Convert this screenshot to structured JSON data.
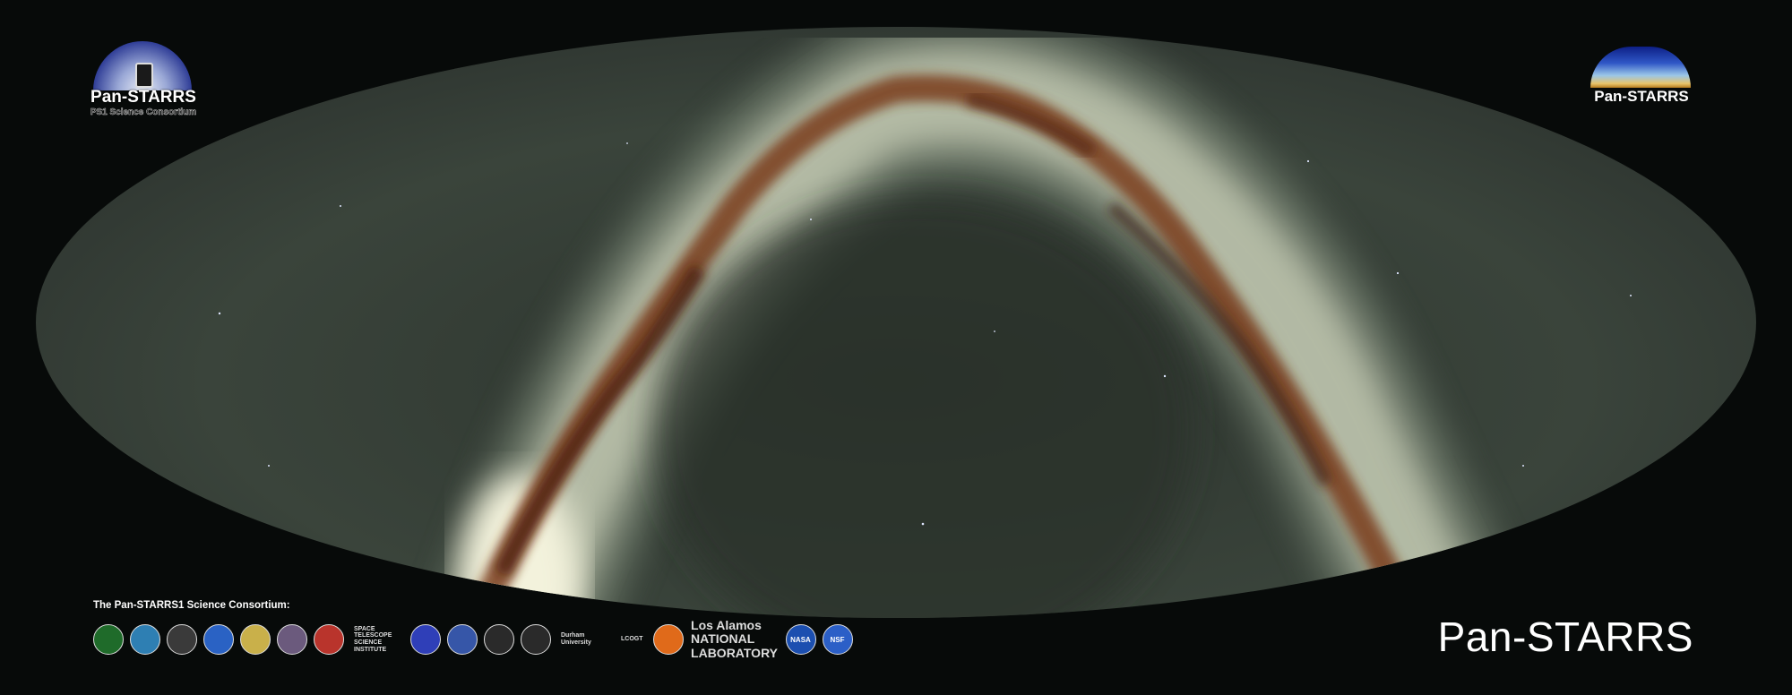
{
  "image": {
    "subject": "all-sky-milky-way",
    "colors": {
      "background": "#070a09",
      "sky_glow": "#3f4a41",
      "band_core": "#e9eedc",
      "dust": "#6a3318"
    }
  },
  "logos": {
    "top_left": {
      "icon": "pan-starrs-consortium-logo",
      "title": "Pan-STARRS",
      "subtitle": "PS1 Science Consortium"
    },
    "top_right": {
      "icon": "pan-starrs-logo",
      "title": "Pan-STARRS"
    }
  },
  "consortium_label": "The Pan-STARRS1 Science Consortium:",
  "partners": [
    {
      "icon": "partner-seal-icon",
      "color": "#1f6b2a",
      "text": ""
    },
    {
      "icon": "partner-seal-icon",
      "color": "#2e7fb3",
      "text": ""
    },
    {
      "icon": "partner-ring-icon",
      "color": "#3a3a3a",
      "text": ""
    },
    {
      "icon": "partner-seal-icon",
      "color": "#2a62c4",
      "text": ""
    },
    {
      "icon": "partner-seal-icon",
      "color": "#c9b04a",
      "text": ""
    },
    {
      "icon": "partner-shield-icon",
      "color": "#6b5a7d",
      "text": ""
    },
    {
      "icon": "partner-seal-icon",
      "color": "#b9342c",
      "text": ""
    },
    {
      "icon": "stsci-icon",
      "color": "#222222",
      "text": "SPACE TELESCOPE SCIENCE INSTITUTE"
    },
    {
      "icon": "partner-seal-icon",
      "color": "#2f3fb8",
      "text": ""
    },
    {
      "icon": "partner-seal-icon",
      "color": "#3656a8",
      "text": ""
    },
    {
      "icon": "partner-seal-icon",
      "color": "#2a2a2a",
      "text": ""
    },
    {
      "icon": "partner-seal-icon",
      "color": "#2a2a2a",
      "text": ""
    },
    {
      "icon": "durham-icon",
      "color": "#5a2a84",
      "text": "Durham University"
    },
    {
      "icon": "lcogt-icon",
      "color": "#1d58c7",
      "text": "LCOGT"
    },
    {
      "icon": "partner-shield-icon",
      "color": "#e06a1a",
      "text": ""
    },
    {
      "icon": "los-alamos-icon",
      "color": "#1a1a1a",
      "text": "Los Alamos NATIONAL LABORATORY"
    },
    {
      "icon": "nasa-icon",
      "color": "#1c4fb0",
      "text": "NASA"
    },
    {
      "icon": "nsf-icon",
      "color": "#2b5fc7",
      "text": "NSF"
    }
  ],
  "brand": "Pan-STARRS"
}
